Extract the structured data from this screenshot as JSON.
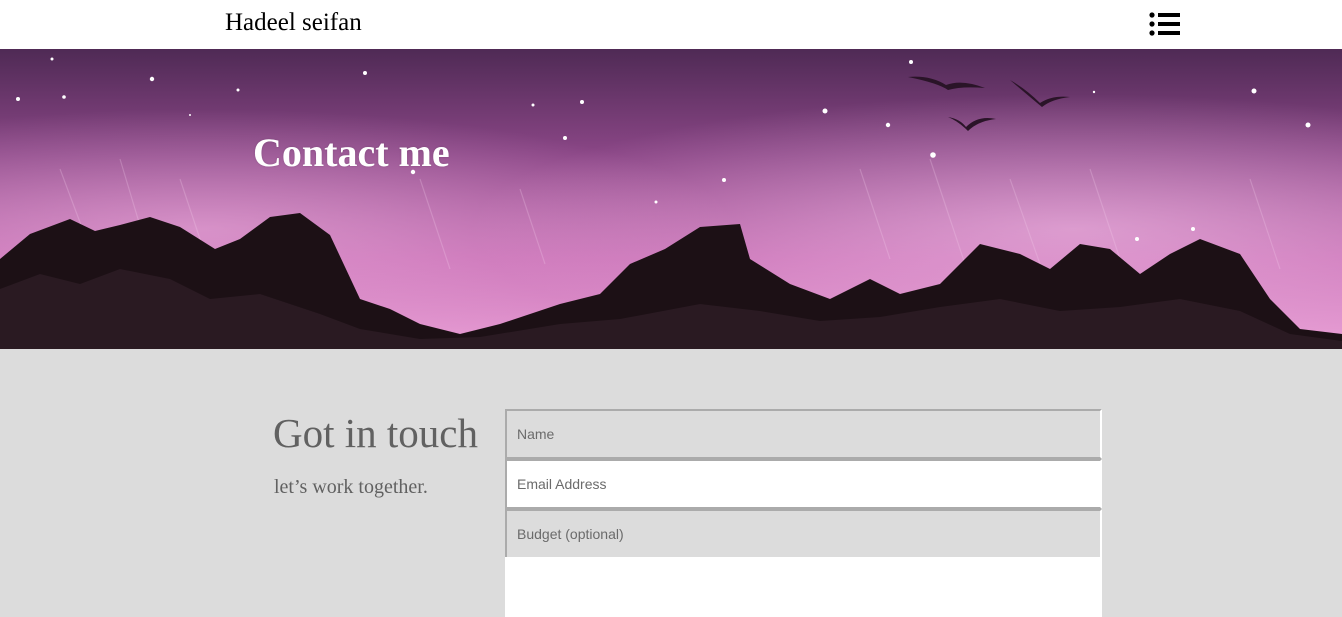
{
  "header": {
    "brand": "Hadeel seifan",
    "menu_icon": "list-menu-icon"
  },
  "hero": {
    "title": "Contact me",
    "colors": {
      "sky_top": "#5a2d5e",
      "sky_mid": "#a24f95",
      "sky_glow": "#e58ac9",
      "mountains": "#1c1015"
    }
  },
  "contact": {
    "heading": "Got in touch",
    "subheading": "let’s work together.",
    "form": {
      "name_placeholder": "Name",
      "email_placeholder": "Email Address",
      "budget_placeholder": "Budget (optional)",
      "message_placeholder": ""
    }
  },
  "colors": {
    "page_background": "#dcdcdc",
    "text_gray": "#616161",
    "field_border": "#ababab"
  }
}
